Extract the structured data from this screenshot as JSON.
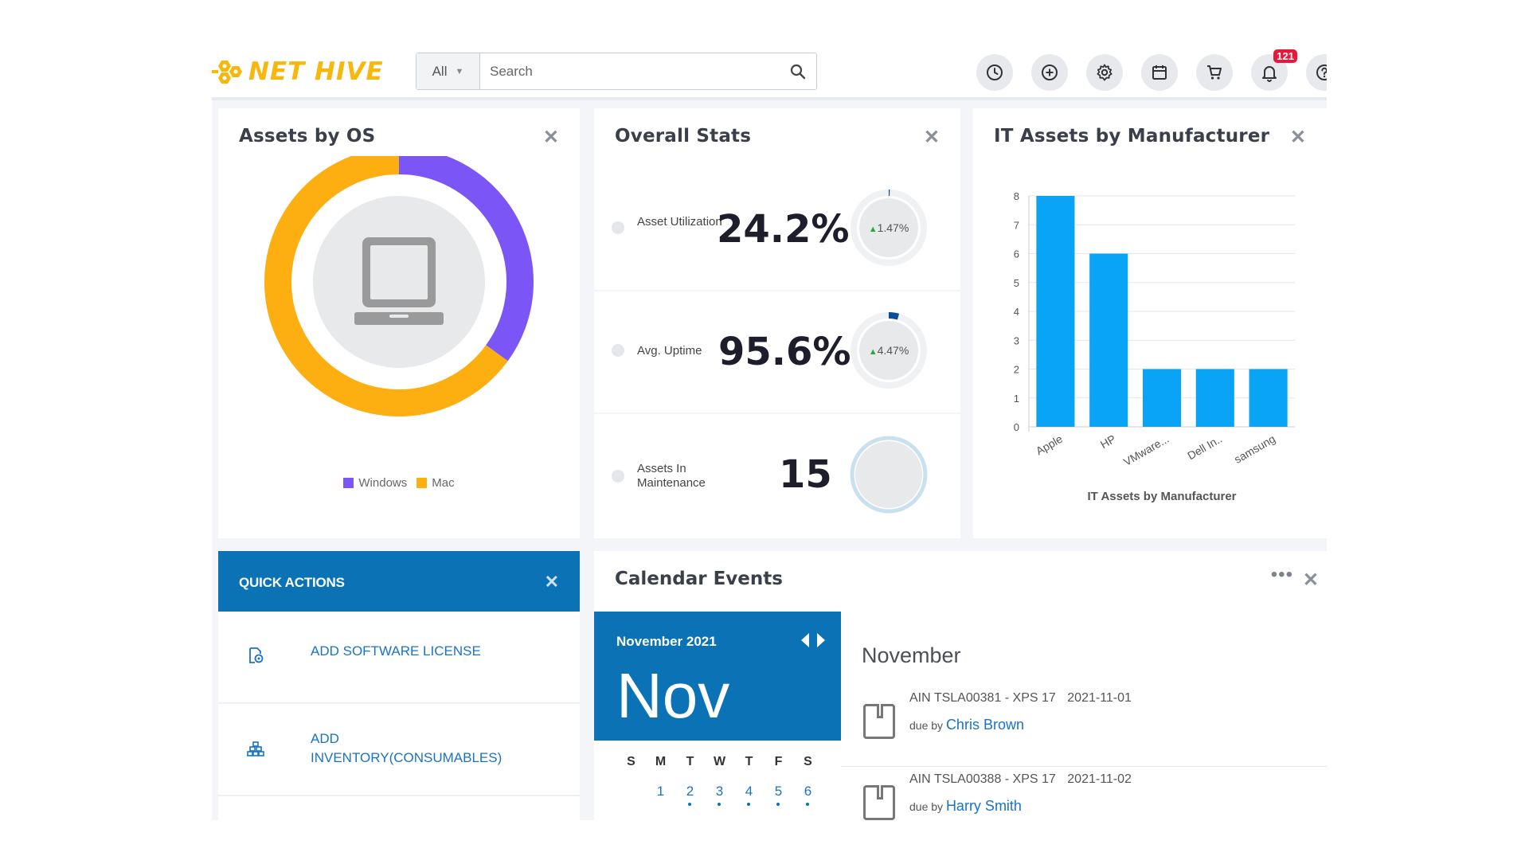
{
  "header": {
    "logo_text": "NET HIVE",
    "search": {
      "scope": "All",
      "placeholder": "Search"
    },
    "icons": [
      "history-icon",
      "add-circle-icon",
      "gear-icon",
      "calendar-icon",
      "cart-icon",
      "bell-icon",
      "help-icon"
    ],
    "notification_count": "121"
  },
  "assets_by_os": {
    "title": "Assets by OS",
    "legend": [
      {
        "label": "Windows",
        "color": "#7b55f5"
      },
      {
        "label": "Mac",
        "color": "#fdae11"
      }
    ]
  },
  "overall_stats": {
    "title": "Overall Stats",
    "items": [
      {
        "label": "Asset Utilization",
        "value": "24.2%",
        "delta": "1.47%"
      },
      {
        "label": "Avg. Uptime",
        "value": "95.6%",
        "delta": "4.47%"
      },
      {
        "label": "Assets In Maintenance",
        "value": "15",
        "delta": ""
      }
    ]
  },
  "it_assets_by_manufacturer": {
    "title": "IT Assets by Manufacturer"
  },
  "quick_actions": {
    "title": "QUICK ACTIONS",
    "items": [
      {
        "label": "ADD SOFTWARE LICENSE"
      },
      {
        "label": "ADD INVENTORY(CONSUMABLES)"
      }
    ]
  },
  "calendar_events": {
    "title": "Calendar Events",
    "month_year": "November 2021",
    "month_short": "Nov",
    "days_of_week": [
      "S",
      "M",
      "T",
      "W",
      "T",
      "F",
      "S"
    ],
    "first_row_days": [
      "",
      "1",
      "2",
      "3",
      "4",
      "5",
      "6"
    ],
    "event_month": "November",
    "events": [
      {
        "title": "AIN TSLA00381 - XPS 17",
        "date": "2021-11-01",
        "due_by_label": "due by",
        "person": "Chris Brown"
      },
      {
        "title": "AIN TSLA00388 - XPS 17",
        "date": "2021-11-02",
        "due_by_label": "due by",
        "person": "Harry Smith"
      }
    ]
  },
  "chart_data": [
    {
      "type": "pie",
      "title": "Assets by OS",
      "categories": [
        "Windows",
        "Mac"
      ],
      "values": [
        35,
        65
      ],
      "colors": [
        "#7b55f5",
        "#fdae11"
      ],
      "legend": "bottom"
    },
    {
      "type": "bar",
      "categories": [
        "Apple",
        "HP",
        "VMware...",
        "Dell In..",
        "samsung"
      ],
      "values": [
        8,
        6,
        2,
        2,
        2
      ],
      "xlabel": "IT Assets by Manufacturer",
      "ylabel": "",
      "ylim": [
        0,
        8
      ],
      "yticks": [
        0,
        1,
        2,
        3,
        4,
        5,
        6,
        7,
        8
      ],
      "grid": true,
      "color": "#0aa4f6"
    }
  ]
}
